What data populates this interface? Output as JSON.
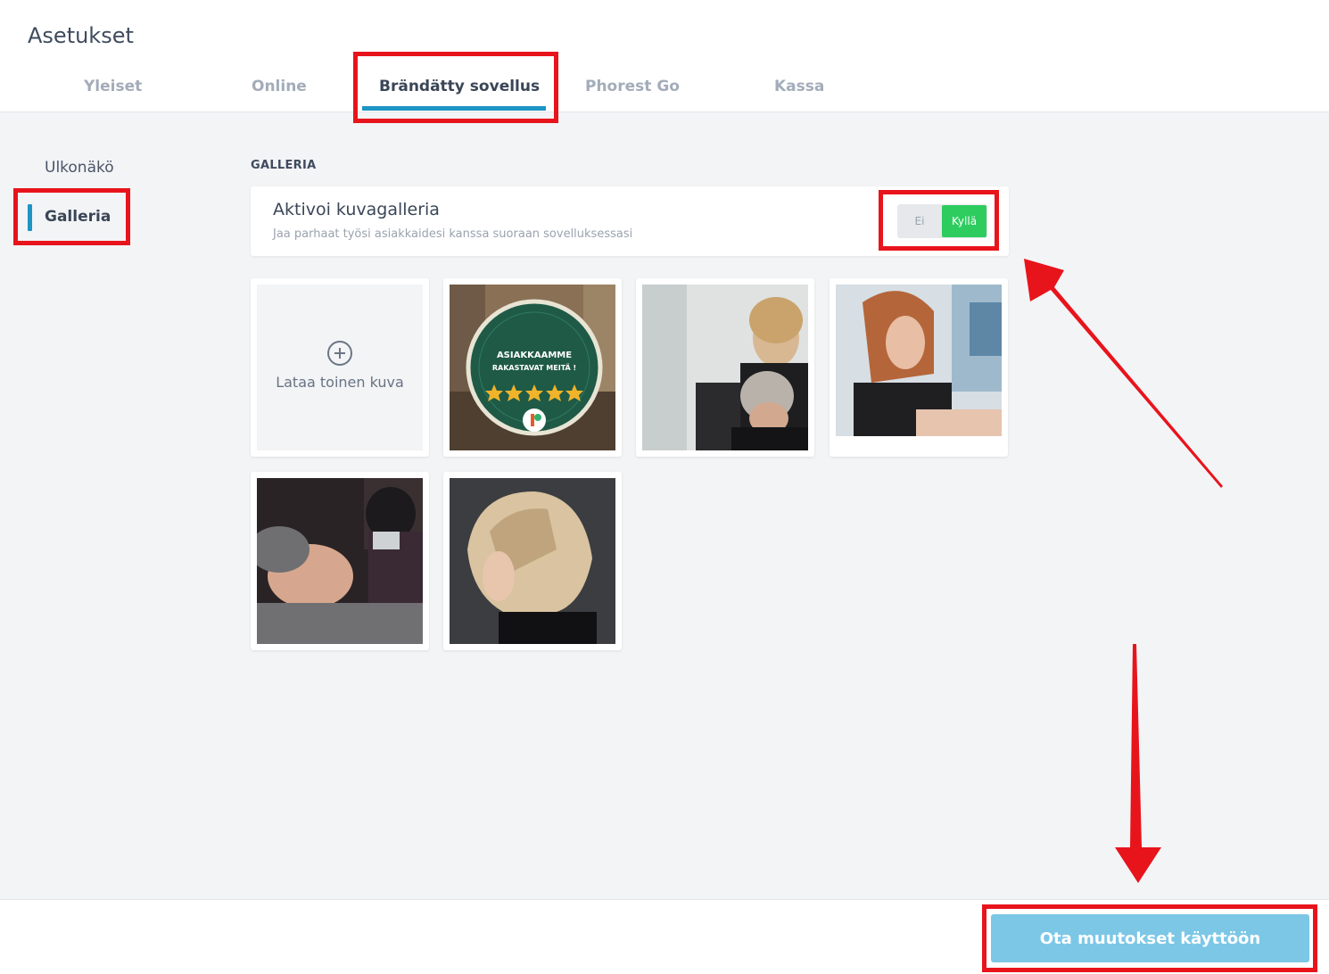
{
  "header": {
    "title": "Asetukset"
  },
  "tabs": [
    {
      "label": "Yleiset",
      "active": false
    },
    {
      "label": "Online",
      "active": false
    },
    {
      "label": "Brändätty sovellus",
      "active": true
    },
    {
      "label": "Phorest Go",
      "active": false
    },
    {
      "label": "Kassa",
      "active": false
    }
  ],
  "sidebar": {
    "items": [
      {
        "label": "Ulkonäkö",
        "active": false
      },
      {
        "label": "Galleria",
        "active": true
      }
    ]
  },
  "gallery": {
    "section_label": "GALLERIA",
    "toggle_card": {
      "title": "Aktivoi kuvagalleria",
      "subtitle": "Jaa parhaat työsi asiakkaidesi kanssa suoraan sovelluksessasi",
      "option_off": "Ei",
      "option_on": "Kyllä",
      "selected": "Kyllä"
    },
    "upload_label": "Lataa toinen kuva",
    "award_badge": {
      "line1": "ASIAKKAAMME",
      "line2": "RAKASTAVAT MEITÄ !"
    }
  },
  "footer": {
    "apply_label": "Ota muutokset käyttöön"
  },
  "colors": {
    "accent": "#1c95c5",
    "toggle_on": "#2ecc5f",
    "apply_button": "#7cc7e6",
    "annotation": "#e8141c"
  }
}
